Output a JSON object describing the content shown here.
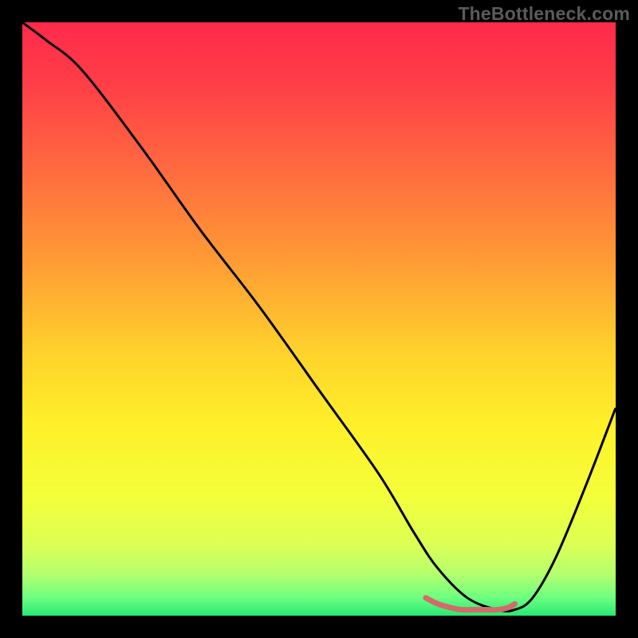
{
  "watermark": "TheBottleneck.com",
  "chart_data": {
    "type": "line",
    "title": "",
    "xlabel": "",
    "ylabel": "",
    "xlim": [
      0,
      100
    ],
    "ylim": [
      0,
      100
    ],
    "series": [
      {
        "name": "bottleneck-curve",
        "x": [
          0,
          4,
          10,
          20,
          30,
          40,
          50,
          60,
          66,
          70,
          75,
          80,
          83,
          86,
          90,
          95,
          100
        ],
        "values": [
          100,
          97,
          92,
          79,
          65,
          52,
          38,
          24,
          14,
          8,
          3,
          1,
          1,
          3,
          10,
          22,
          35
        ]
      },
      {
        "name": "optimal-range-marker",
        "x": [
          68,
          70,
          72,
          74,
          76,
          78,
          80,
          82,
          83
        ],
        "values": [
          3.0,
          2.0,
          1.4,
          1.0,
          1.0,
          1.0,
          1.0,
          1.4,
          2.0
        ]
      }
    ],
    "gradient_stops": [
      {
        "offset": 0.0,
        "color": "#ff2a4b"
      },
      {
        "offset": 0.1,
        "color": "#ff3d47"
      },
      {
        "offset": 0.25,
        "color": "#ff6b3f"
      },
      {
        "offset": 0.4,
        "color": "#ff9a35"
      },
      {
        "offset": 0.55,
        "color": "#ffd02c"
      },
      {
        "offset": 0.68,
        "color": "#fff029"
      },
      {
        "offset": 0.8,
        "color": "#f3ff3a"
      },
      {
        "offset": 0.88,
        "color": "#dcff55"
      },
      {
        "offset": 0.93,
        "color": "#b4ff6e"
      },
      {
        "offset": 0.97,
        "color": "#6cff80"
      },
      {
        "offset": 1.0,
        "color": "#28e874"
      }
    ],
    "colors": {
      "curve_stroke": "#000000",
      "marker_stroke": "#d46b6b",
      "background": "#000000"
    }
  }
}
